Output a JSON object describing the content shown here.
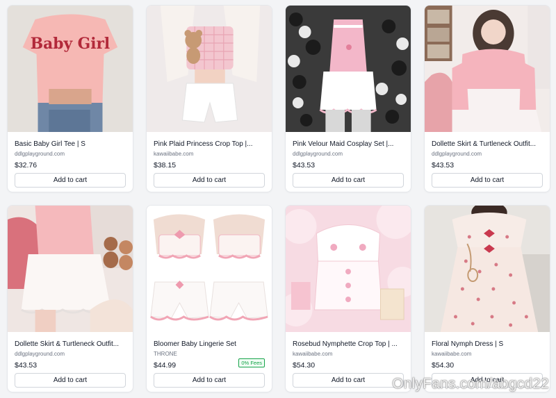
{
  "products": [
    {
      "title": "Basic Baby Girl Tee | S",
      "store": "ddlgplayground.com",
      "price": "$32.76",
      "button": "Add to cart",
      "image_text": "Baby Girl"
    },
    {
      "title": "Pink Plaid Princess Crop Top |...",
      "store": "kawaiibabe.com",
      "price": "$38.15",
      "button": "Add to cart"
    },
    {
      "title": "Pink Velour Maid Cosplay Set |...",
      "store": "ddlgplayground.com",
      "price": "$43.53",
      "button": "Add to cart"
    },
    {
      "title": "Dollette Skirt & Turtleneck Outfit...",
      "store": "ddlgplayground.com",
      "price": "$43.53",
      "button": "Add to cart"
    },
    {
      "title": "Dollette Skirt & Turtleneck Outfit...",
      "store": "ddlgplayground.com",
      "price": "$43.53",
      "button": "Add to cart"
    },
    {
      "title": "Bloomer Baby Lingerie Set",
      "store": "THRONE",
      "price": "$44.99",
      "button": "Add to cart",
      "badge": "0% Fees"
    },
    {
      "title": "Rosebud Nymphette Crop Top | ...",
      "store": "kawaiibabe.com",
      "price": "$54.30",
      "button": "Add to cart"
    },
    {
      "title": "Floral Nymph Dress | S",
      "store": "kawaiibabe.com",
      "price": "$54.30",
      "button": "Add to cart"
    }
  ],
  "watermark": "OnlyFans.com/abgcd22",
  "colors": {
    "accent_pink": "#f4b6c2",
    "fees_green": "#16a34a",
    "border": "#e5e7eb"
  }
}
